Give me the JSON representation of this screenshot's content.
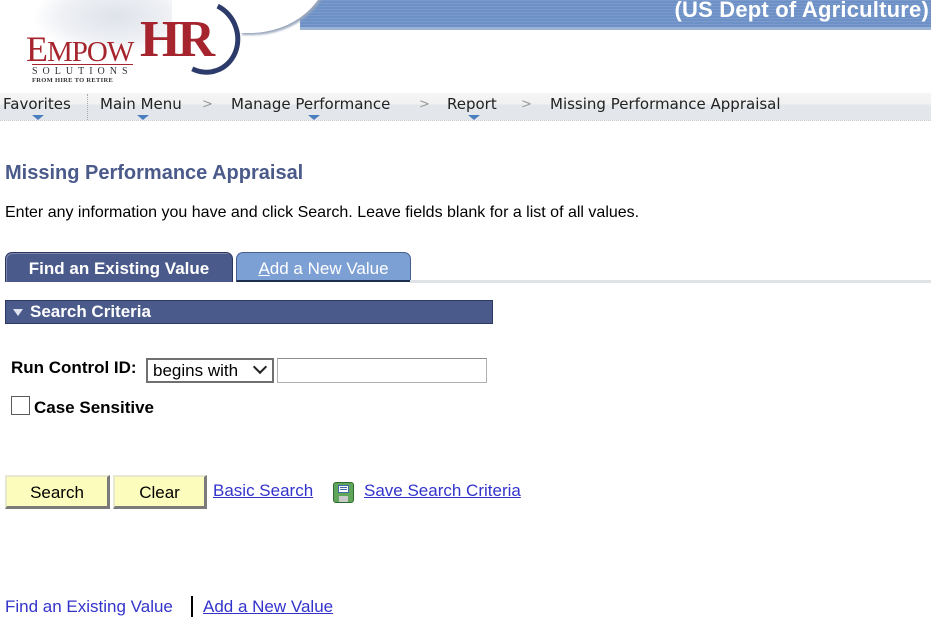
{
  "banner": {
    "title": "(US Dept of Agriculture)",
    "logo": {
      "empow_first": "E",
      "empow_rest": "MPOW",
      "hr": "HR",
      "solutions": "SOLUTIONS",
      "tagline": "FROM HIRE TO RETIRE"
    },
    "band_color": "#6d91c6"
  },
  "navbar": {
    "items": [
      {
        "label": "Favorites",
        "has_menu": true
      },
      {
        "label": "Main Menu",
        "has_menu": true
      },
      {
        "label": "Manage Performance",
        "has_menu": true
      },
      {
        "label": "Report",
        "has_menu": true
      },
      {
        "label": "Missing Performance Appraisal",
        "has_menu": false
      }
    ],
    "separator": ">"
  },
  "page": {
    "title": "Missing Performance Appraisal",
    "instructions": "Enter any information you have and click Search. Leave fields blank for a list of all values.",
    "accent_color": "#4a5a8a"
  },
  "tabs": [
    {
      "label": "Find an Existing Value",
      "active": true
    },
    {
      "label_hotkey": "A",
      "label_rest": "dd a New Value",
      "active": false
    }
  ],
  "search_criteria": {
    "header": "Search Criteria",
    "run_control_id": {
      "label": "Run Control ID:",
      "operator": "begins with",
      "value": "",
      "placeholder": ""
    },
    "case_sensitive": {
      "label": "Case Sensitive",
      "checked": false
    }
  },
  "actions": {
    "search_label": "Search",
    "clear_label": "Clear",
    "basic_search_label": "Basic Search",
    "save_icon": "floppy-disk-icon",
    "save_search_label": "Save Search Criteria",
    "button_color": "#fcfcbc",
    "link_color": "#3333cc"
  },
  "footer": {
    "find_existing_label": "Find an Existing Value",
    "add_new_label": "Add a New Value"
  }
}
